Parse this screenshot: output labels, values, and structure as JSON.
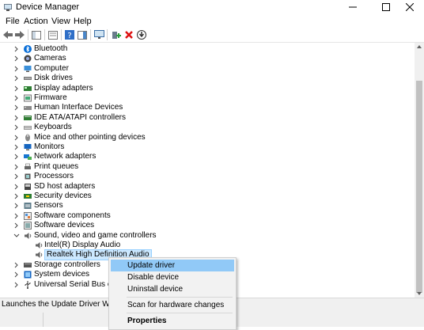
{
  "window": {
    "title": "Device Manager"
  },
  "menu": [
    "File",
    "Action",
    "View",
    "Help"
  ],
  "tree": {
    "categories": [
      {
        "label": "Bluetooth",
        "icon": "bluetooth-icon",
        "expanded": false
      },
      {
        "label": "Cameras",
        "icon": "camera-icon",
        "expanded": false
      },
      {
        "label": "Computer",
        "icon": "computer-icon",
        "expanded": false
      },
      {
        "label": "Disk drives",
        "icon": "disk-drive-icon",
        "expanded": false
      },
      {
        "label": "Display adapters",
        "icon": "display-adapter-icon",
        "expanded": false
      },
      {
        "label": "Firmware",
        "icon": "firmware-icon",
        "expanded": false
      },
      {
        "label": "Human Interface Devices",
        "icon": "hid-icon",
        "expanded": false
      },
      {
        "label": "IDE ATA/ATAPI controllers",
        "icon": "ide-controller-icon",
        "expanded": false
      },
      {
        "label": "Keyboards",
        "icon": "keyboard-icon",
        "expanded": false
      },
      {
        "label": "Mice and other pointing devices",
        "icon": "mouse-icon",
        "expanded": false
      },
      {
        "label": "Monitors",
        "icon": "monitor-icon",
        "expanded": false
      },
      {
        "label": "Network adapters",
        "icon": "network-adapter-icon",
        "expanded": false
      },
      {
        "label": "Print queues",
        "icon": "printer-icon",
        "expanded": false
      },
      {
        "label": "Processors",
        "icon": "processor-icon",
        "expanded": false
      },
      {
        "label": "SD host adapters",
        "icon": "sd-host-icon",
        "expanded": false
      },
      {
        "label": "Security devices",
        "icon": "security-device-icon",
        "expanded": false
      },
      {
        "label": "Sensors",
        "icon": "sensor-icon",
        "expanded": false
      },
      {
        "label": "Software components",
        "icon": "software-component-icon",
        "expanded": false
      },
      {
        "label": "Software devices",
        "icon": "software-device-icon",
        "expanded": false
      },
      {
        "label": "Sound, video and game controllers",
        "icon": "speaker-icon",
        "expanded": true,
        "children": [
          {
            "label": "Intel(R) Display Audio",
            "icon": "speaker-icon",
            "selected": false
          },
          {
            "label": "Realtek High Definition Audio",
            "icon": "speaker-icon",
            "selected": true
          }
        ]
      },
      {
        "label": "Storage controllers",
        "icon": "storage-controller-icon",
        "expanded": false
      },
      {
        "label": "System devices",
        "icon": "system-device-icon",
        "expanded": false
      },
      {
        "label": "Universal Serial Bus contro",
        "icon": "usb-icon",
        "expanded": false
      }
    ]
  },
  "context_menu": {
    "items": [
      {
        "label": "Update driver",
        "highlighted": true
      },
      {
        "label": "Disable device"
      },
      {
        "label": "Uninstall device"
      },
      {
        "label": "Scan for hardware changes"
      },
      {
        "label": "Properties",
        "bold": true
      }
    ]
  },
  "status": {
    "text": "Launches the Update Driver Wizard fo"
  },
  "colors": {
    "selection": "#cce8ff",
    "menu_highlight": "#91c9f7",
    "accent": "#0078d7"
  }
}
